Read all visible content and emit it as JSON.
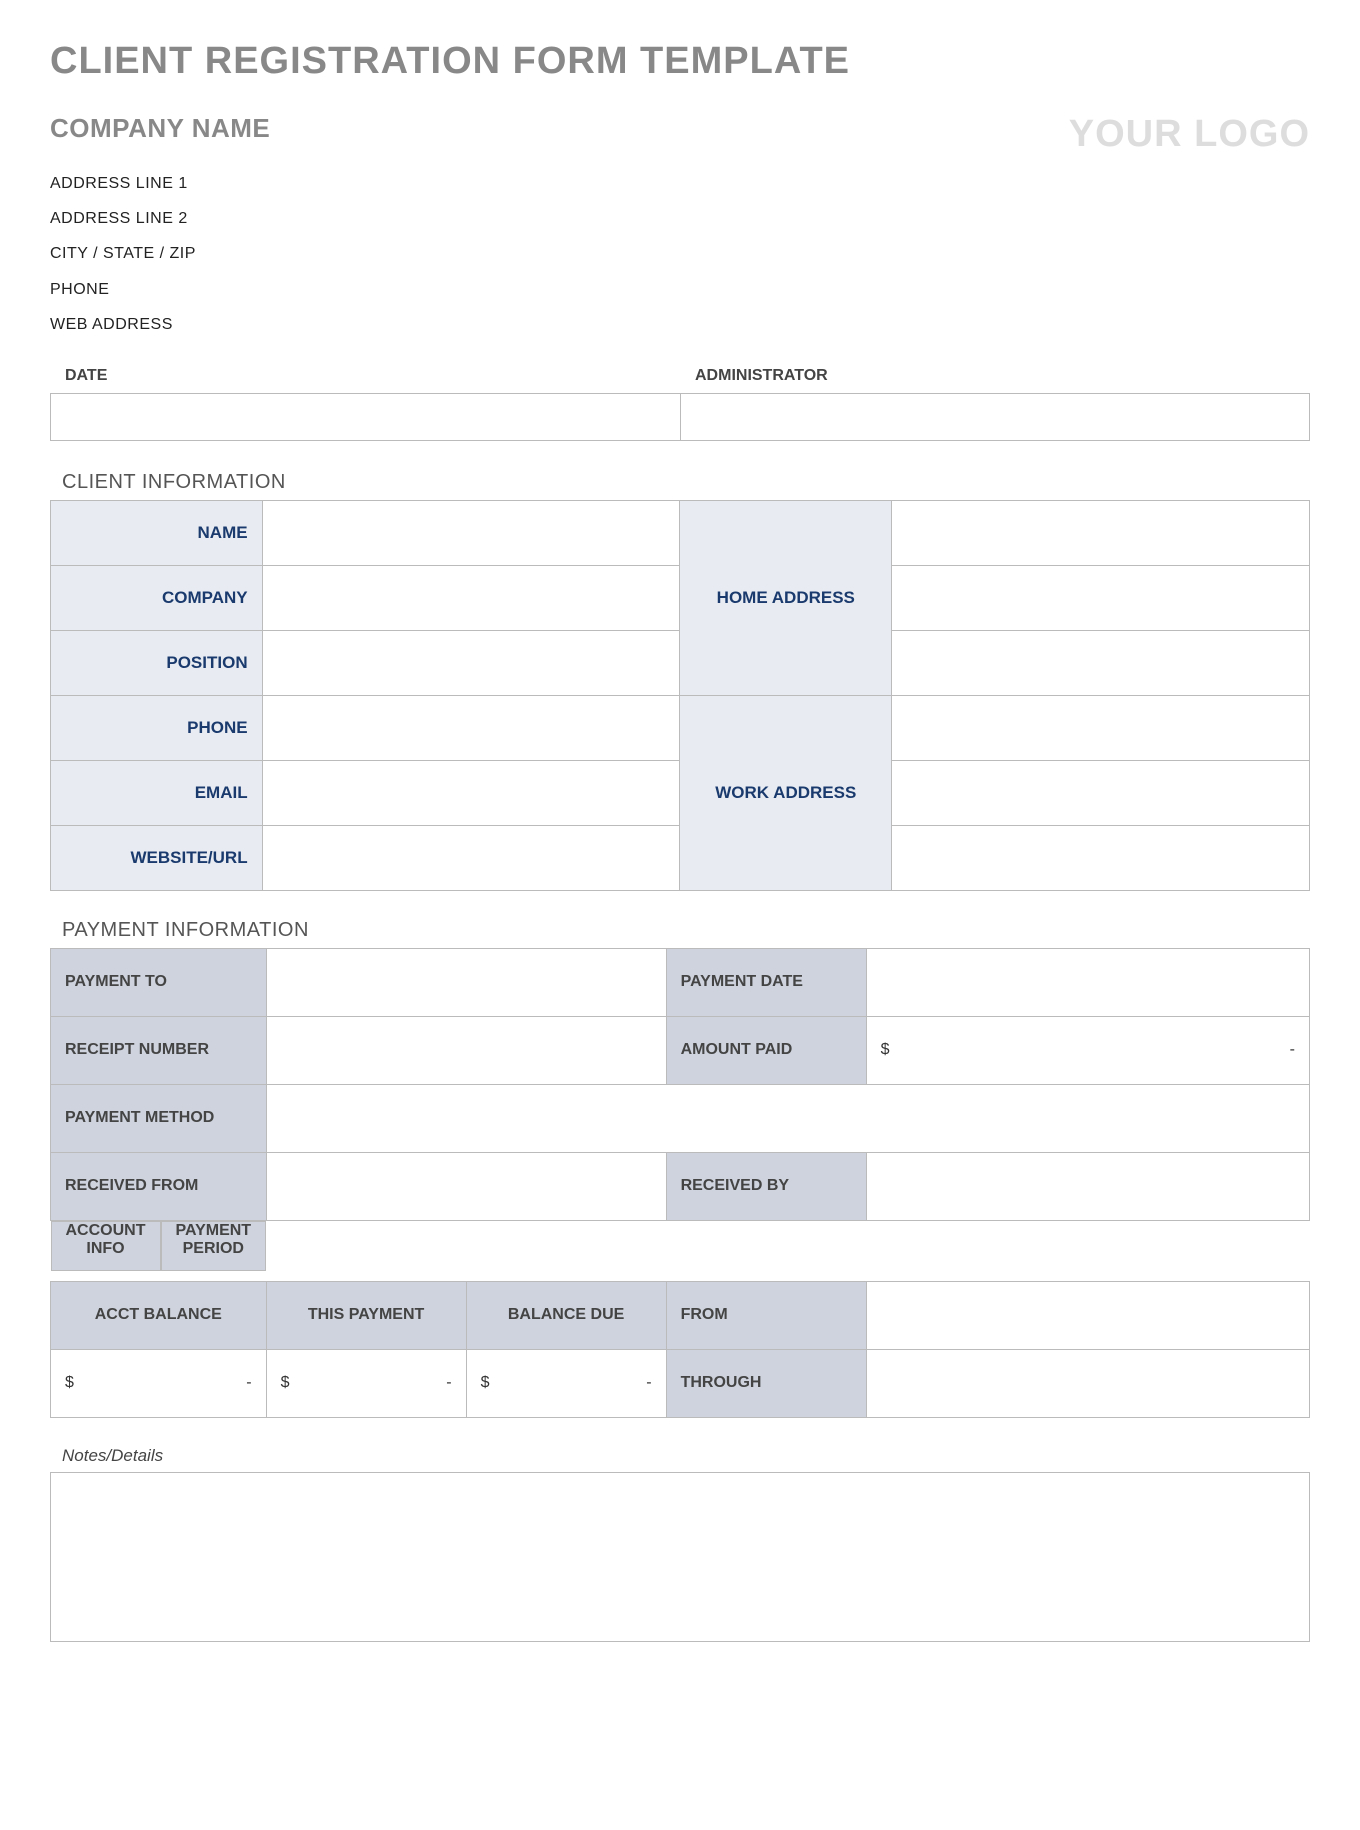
{
  "page_title": "CLIENT REGISTRATION FORM TEMPLATE",
  "header": {
    "company_name": "COMPANY NAME",
    "logo_text": "YOUR LOGO",
    "address_line_1": "ADDRESS LINE 1",
    "address_line_2": "ADDRESS LINE 2",
    "city_state_zip": "CITY / STATE / ZIP",
    "phone": "PHONE",
    "web_address": "WEB ADDRESS"
  },
  "date_admin": {
    "date_label": "DATE",
    "date_value": "",
    "admin_label": "ADMINISTRATOR",
    "admin_value": ""
  },
  "client_info": {
    "section_title": "CLIENT INFORMATION",
    "labels": {
      "name": "NAME",
      "company": "COMPANY",
      "position": "POSITION",
      "phone": "PHONE",
      "email": "EMAIL",
      "website": "WEBSITE/URL",
      "home_address": "HOME ADDRESS",
      "work_address": "WORK ADDRESS"
    },
    "values": {
      "name": "",
      "company": "",
      "position": "",
      "phone": "",
      "email": "",
      "website": "",
      "home_address_1": "",
      "home_address_2": "",
      "home_address_3": "",
      "work_address_1": "",
      "work_address_2": "",
      "work_address_3": ""
    }
  },
  "payment_info": {
    "section_title": "PAYMENT INFORMATION",
    "labels": {
      "payment_to": "PAYMENT TO",
      "receipt_number": "RECEIPT NUMBER",
      "payment_method": "PAYMENT METHOD",
      "received_from": "RECEIVED FROM",
      "payment_date": "PAYMENT DATE",
      "amount_paid": "AMOUNT PAID",
      "received_by": "RECEIVED BY",
      "account_info": "ACCOUNT INFO",
      "payment_period": "PAYMENT PERIOD",
      "acct_balance": "ACCT BALANCE",
      "this_payment": "THIS PAYMENT",
      "balance_due": "BALANCE DUE",
      "from": "FROM",
      "through": "THROUGH"
    },
    "values": {
      "payment_to": "",
      "receipt_number": "",
      "payment_method": "",
      "received_from": "",
      "payment_date": "",
      "received_by": "",
      "from": "",
      "through": ""
    },
    "money": {
      "dollar": "$",
      "dash": "-"
    }
  },
  "notes": {
    "label": "Notes/Details",
    "value": ""
  }
}
